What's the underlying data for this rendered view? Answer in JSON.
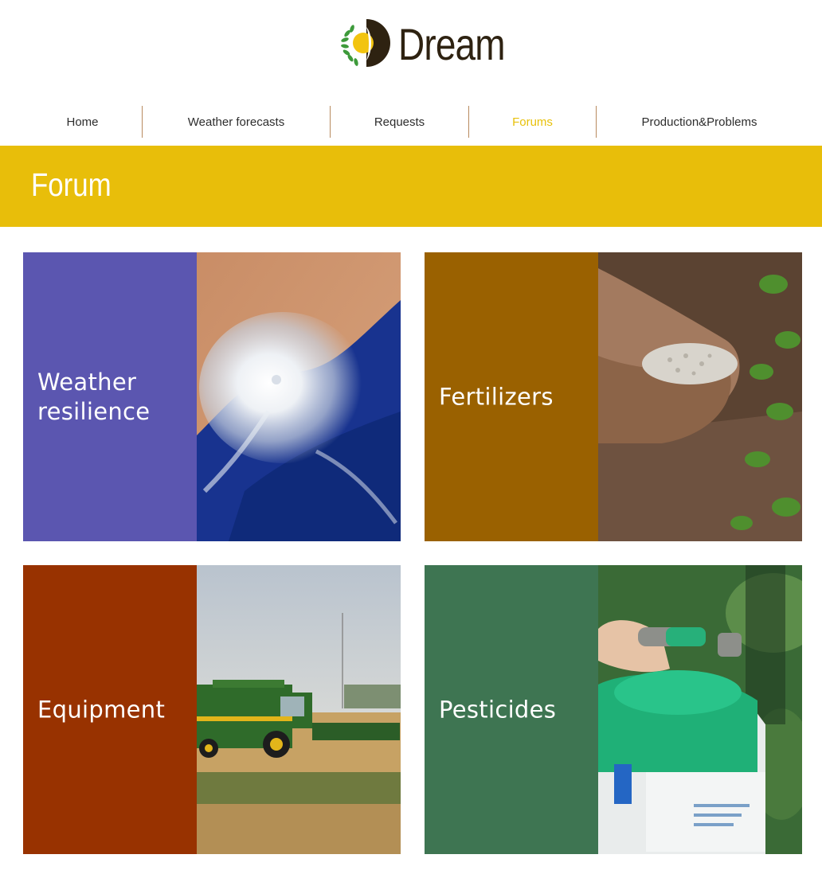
{
  "site": {
    "logo_text": "Dream"
  },
  "nav": {
    "items": [
      {
        "label": "Home",
        "active": false
      },
      {
        "label": "Weather forecasts",
        "active": false
      },
      {
        "label": "Requests",
        "active": false
      },
      {
        "label": "Forums",
        "active": true
      },
      {
        "label": "Production&Problems",
        "active": false
      }
    ]
  },
  "banner": {
    "title": "Forum"
  },
  "cards": [
    {
      "label": "Weather resilience",
      "color": "#5b56b0",
      "image": "hurricane-satellite-image"
    },
    {
      "label": "Fertilizers",
      "color": "#9a6100",
      "image": "hands-holding-fertilizer-image"
    },
    {
      "label": "Equipment",
      "color": "#983200",
      "image": "combine-harvester-image"
    },
    {
      "label": "Pesticides",
      "color": "#3e7552",
      "image": "pesticide-sprayer-image"
    }
  ],
  "colors": {
    "accent": "#e8be0a",
    "nav_active": "#e8c10c",
    "nav_divider": "#b88a5e",
    "logo_text": "#2e2211"
  }
}
